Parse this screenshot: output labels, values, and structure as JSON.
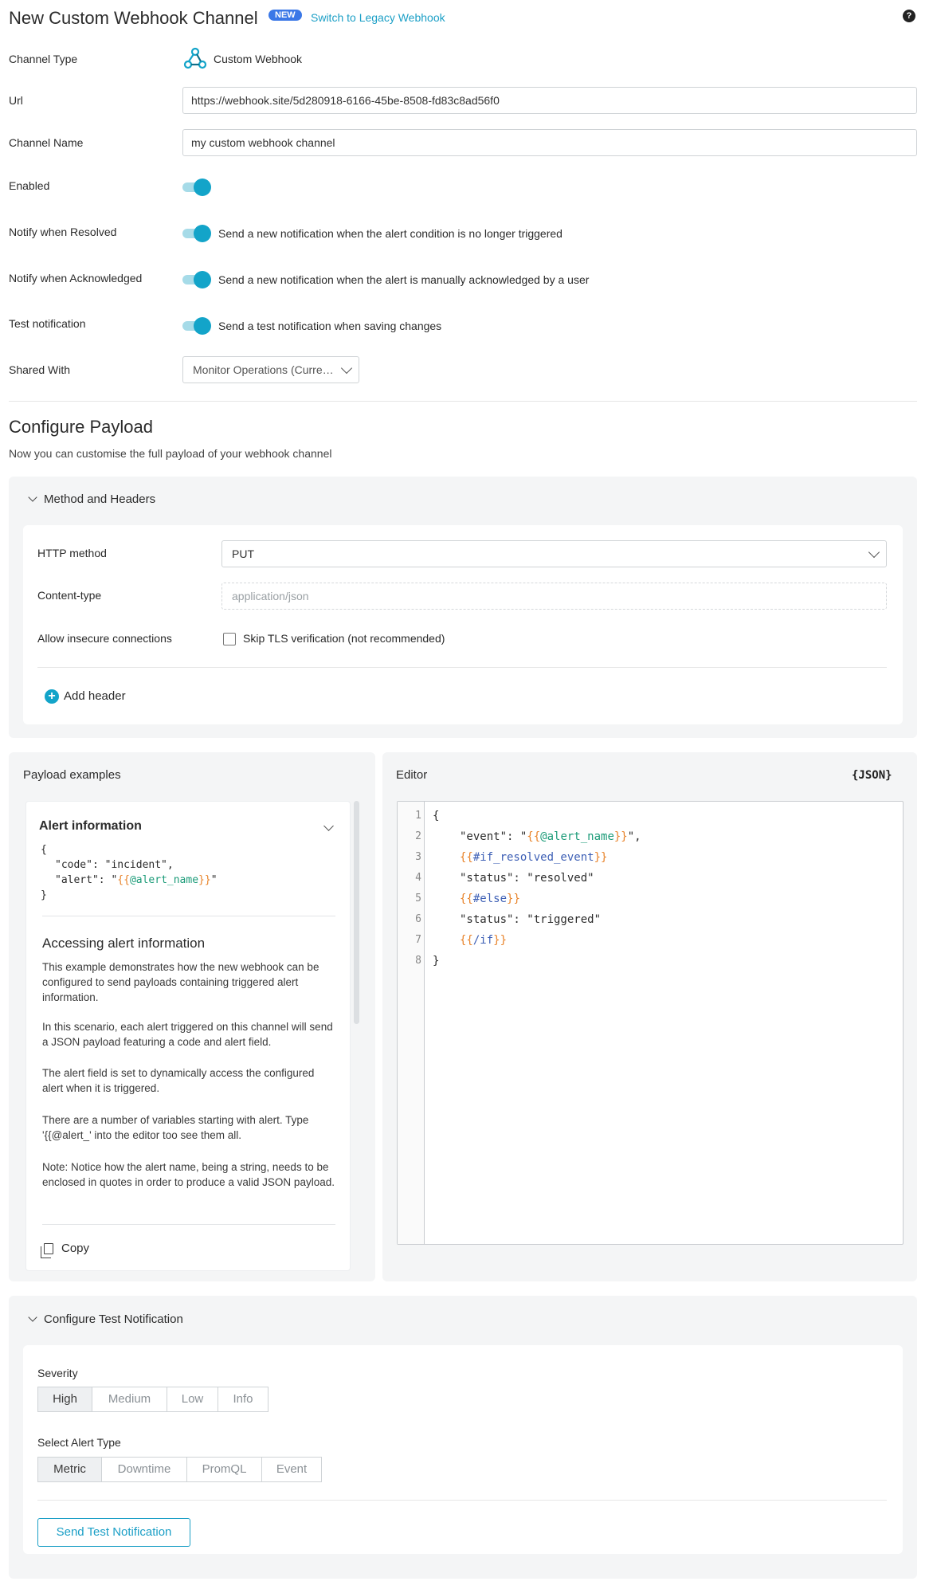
{
  "header": {
    "title": "New Custom Webhook Channel",
    "badge": "NEW",
    "legacy_link": "Switch to Legacy Webhook",
    "help_icon": "question-circle-icon"
  },
  "form": {
    "channel_type_label": "Channel Type",
    "channel_type_value": "Custom Webhook",
    "url_label": "Url",
    "url_value": "https://webhook.site/5d280918-6166-45be-8508-fd83c8ad56f0",
    "name_label": "Channel Name",
    "name_value": "my custom webhook channel",
    "enabled_label": "Enabled",
    "notify_resolved_label": "Notify when Resolved",
    "notify_resolved_text": "Send a new notification when the alert condition is no longer triggered",
    "notify_ack_label": "Notify when Acknowledged",
    "notify_ack_text": "Send a new notification when the alert is manually acknowledged by a user",
    "test_label": "Test notification",
    "test_text": "Send a test notification when saving changes",
    "shared_label": "Shared With",
    "shared_value": "Monitor Operations (Curre…",
    "toggle_color": "#13a4c9"
  },
  "payload": {
    "title": "Configure Payload",
    "subtitle": "Now you can customise the full payload of your webhook channel"
  },
  "method_headers": {
    "title": "Method and Headers",
    "http_method_label": "HTTP method",
    "http_method_value": "PUT",
    "content_type_label": "Content-type",
    "content_type_placeholder": "application/json",
    "insecure_label": "Allow insecure connections",
    "skip_tls_label": "Skip TLS verification (not recommended)",
    "add_header": "Add header"
  },
  "examples": {
    "header": "Payload examples",
    "card_title": "Alert information",
    "code": {
      "l1": "{",
      "l2_key": "\"code\": \"incident\",",
      "l3_key": "\"alert\": \"",
      "l3_open": "{{",
      "l3_var": "@alert_name",
      "l3_close": "}}",
      "l3_end": "\"",
      "l4": "}"
    },
    "heading": "Accessing alert information",
    "p1": "This example demonstrates how the new webhook can be configured to send payloads containing triggered alert information.",
    "p2": "In this scenario, each alert triggered on this channel will send a JSON payload featuring a code and alert field.",
    "p3": "The alert field is set to dynamically access the configured alert when it is triggered.",
    "p4": "There are a number of variables starting with alert. Type '{{@alert_' into the editor too see them all.",
    "p5": "Note: Notice how the alert name, being a string, needs to be enclosed in quotes in order to produce a valid JSON payload.",
    "copy": "Copy"
  },
  "editor": {
    "header": "Editor",
    "badge": "{JSON}",
    "line_numbers": [
      "1",
      "2",
      "3",
      "4",
      "5",
      "6",
      "7",
      "8"
    ],
    "l1": "{",
    "l2_key": "\"event\": \"",
    "l2_open": "{{",
    "l2_var": "@alert_name",
    "l2_close": "}}",
    "l2_end": "\",",
    "l3": "{{#if_resolved_event}}",
    "l3_open": "{{",
    "l3_var": "#if_resolved_event",
    "l3_close": "}}",
    "l4": "\"status\": \"resolved\"",
    "l5_open": "{{",
    "l5_var": "#else",
    "l5_close": "}}",
    "l6": "\"status\": \"triggered\"",
    "l7_open": "{{",
    "l7_var": "/if",
    "l7_close": "}}",
    "l8": "}"
  },
  "test_notification": {
    "title": "Configure Test Notification",
    "severity_label": "Severity",
    "severity_options": [
      "High",
      "Medium",
      "Low",
      "Info"
    ],
    "severity_selected": "High",
    "alert_type_label": "Select Alert Type",
    "alert_type_options": [
      "Metric",
      "Downtime",
      "PromQL",
      "Event"
    ],
    "alert_type_selected": "Metric",
    "send_button": "Send Test Notification"
  }
}
